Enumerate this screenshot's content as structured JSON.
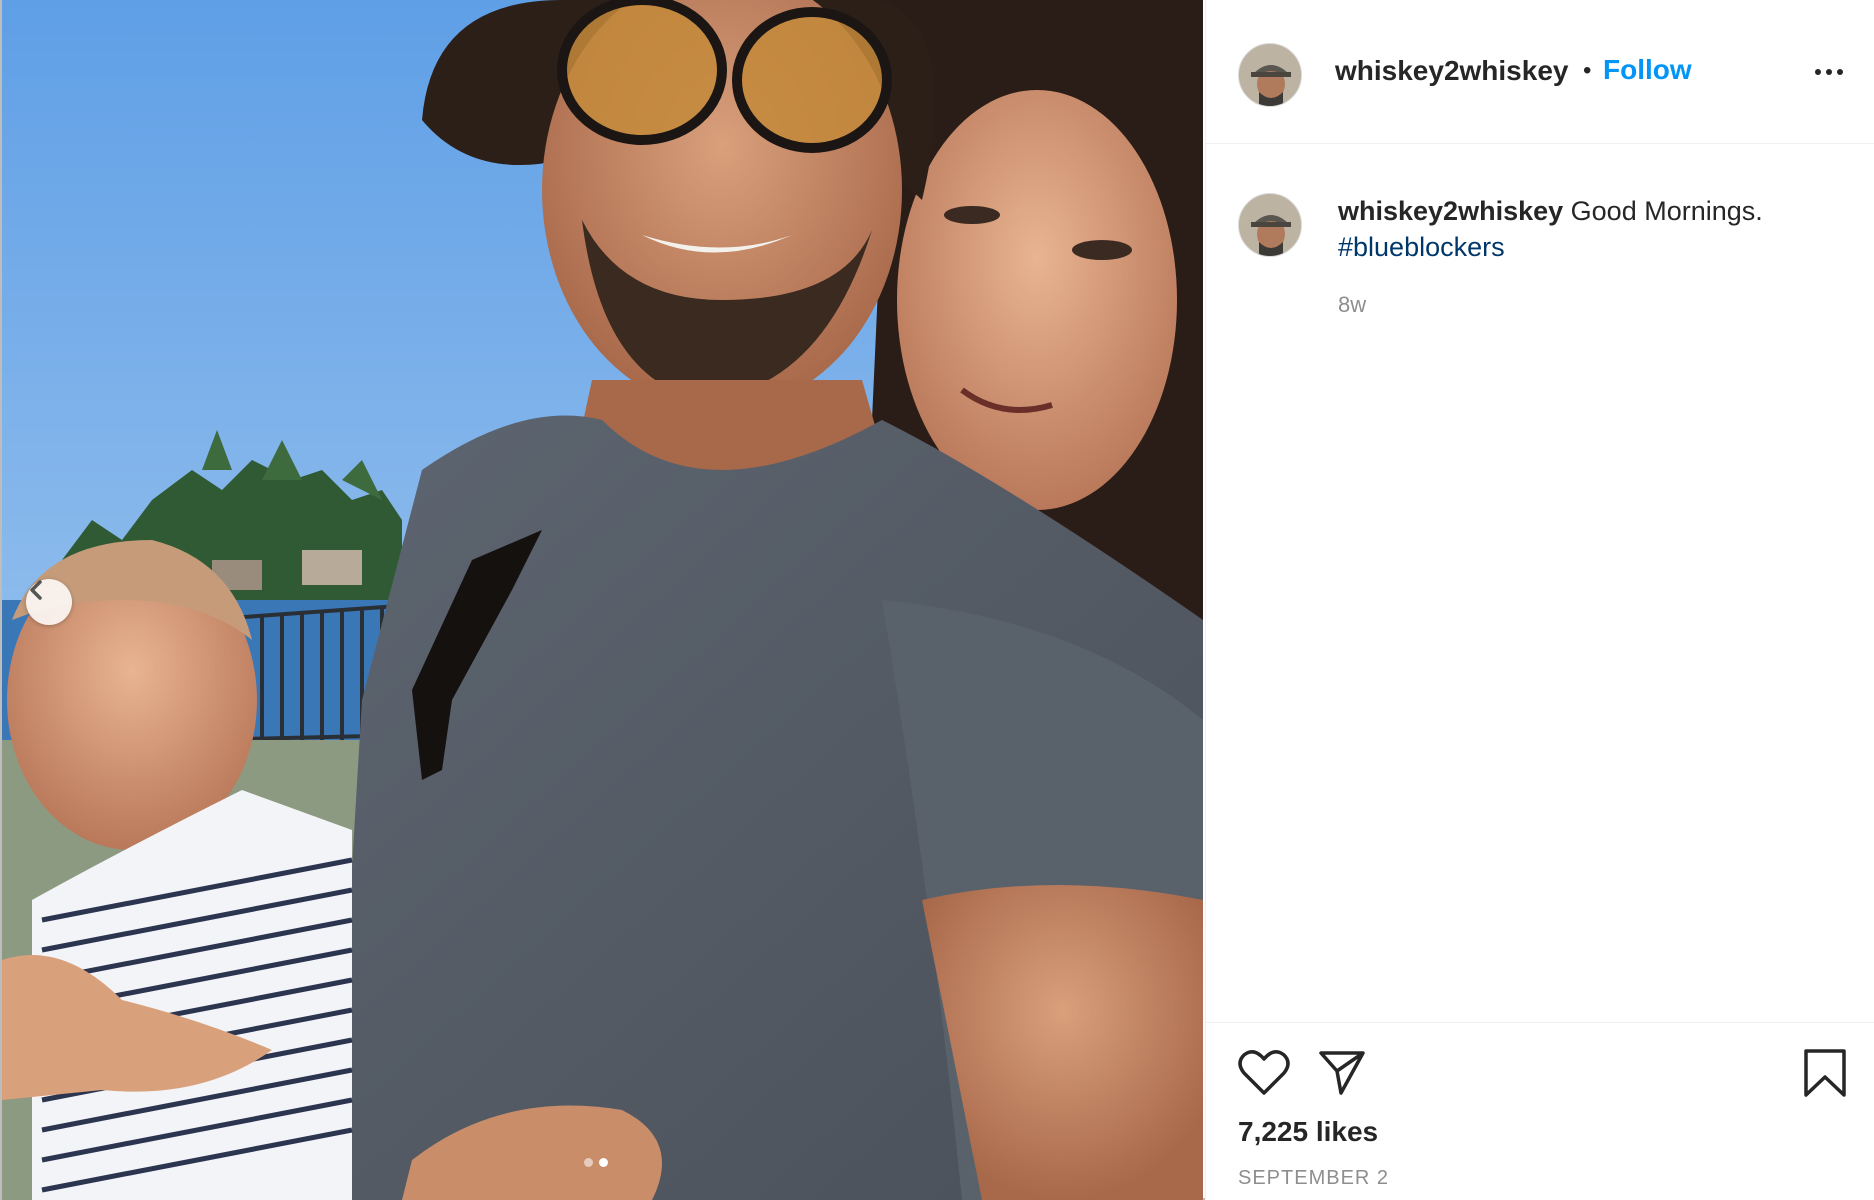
{
  "post": {
    "photo": {
      "alt_icon": "photo",
      "carousel_prev_icon": "chevron-left-icon",
      "dots": [
        {
          "active": false
        },
        {
          "active": true
        }
      ]
    },
    "header": {
      "avatar_icon": "avatar",
      "username": "whiskey2whiskey",
      "separator": "•",
      "follow_label": "Follow",
      "more_icon": "more-horizontal-icon"
    },
    "caption": {
      "username": "whiskey2whiskey",
      "text": "Good Mornings.",
      "hashtag": "#blueblockers",
      "time": "8w"
    },
    "footer": {
      "like_icon": "heart-icon",
      "share_icon": "send-icon",
      "save_icon": "bookmark-icon",
      "likes": "7,225 likes",
      "date": "September 2"
    },
    "colors": {
      "link": "#0095f6",
      "hashtag": "#00376b",
      "muted": "#8e8e8e",
      "text": "#262626"
    }
  }
}
